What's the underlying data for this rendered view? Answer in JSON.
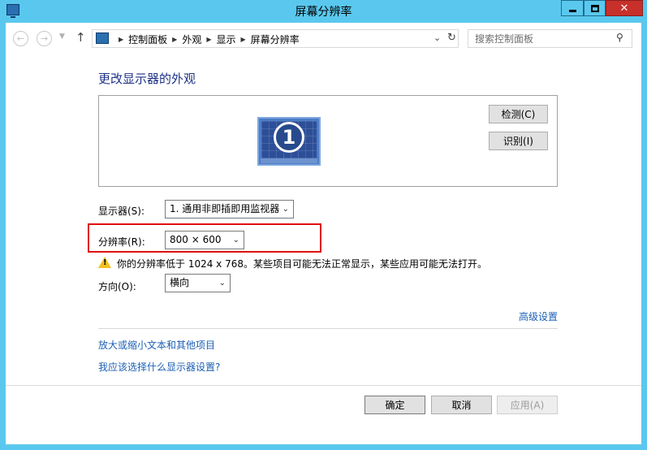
{
  "window": {
    "title": "屏幕分辨率"
  },
  "address": {
    "crumbs": [
      "控制面板",
      "外观",
      "显示",
      "屏幕分辨率"
    ],
    "search_placeholder": "搜索控制面板"
  },
  "main": {
    "heading": "更改显示器的外观",
    "monitor_number": "1",
    "detect_label": "检测(C)",
    "identify_label": "识别(I)",
    "display_label": "显示器(S):",
    "display_value": "1. 通用非即插即用监视器",
    "resolution_label": "分辨率(R):",
    "resolution_value": "800 × 600",
    "warning_text": "你的分辨率低于 1024 x 768。某些项目可能无法正常显示，某些应用可能无法打开。",
    "orientation_label": "方向(O):",
    "orientation_value": "横向",
    "advanced_link": "高级设置",
    "link_text_size": "放大或缩小文本和其他项目",
    "link_which_settings": "我应该选择什么显示器设置?"
  },
  "footer": {
    "ok_label": "确定",
    "cancel_label": "取消",
    "apply_label": "应用(A)"
  },
  "colors": {
    "title_bar": "#5ac8ee",
    "heading": "#1e3287",
    "link": "#1c5fb5",
    "highlight": "#e01010",
    "close_button": "#c7302b"
  }
}
